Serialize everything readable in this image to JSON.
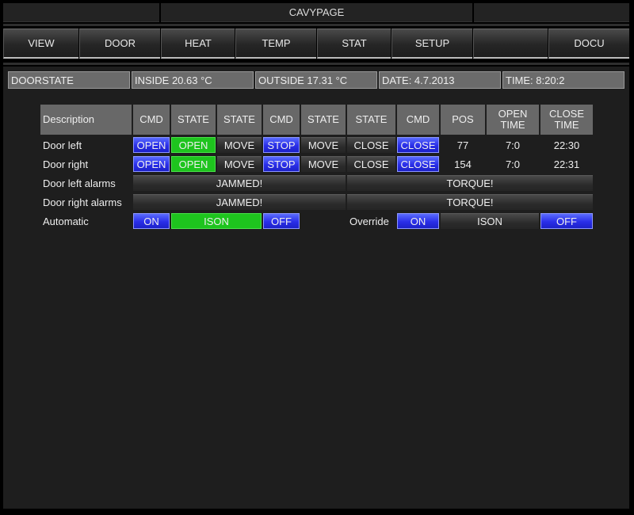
{
  "title": "CAVYPAGE",
  "nav": [
    "VIEW",
    "DOOR",
    "HEAT",
    "TEMP",
    "STAT",
    "SETUP",
    "",
    "DOCU"
  ],
  "status": {
    "name": "DOORSTATE",
    "inside": "INSIDE 20.63 °C",
    "outside": "OUTSIDE 17.31 °C",
    "date": "DATE: 4.7.2013",
    "time": "TIME: 8:20:2"
  },
  "headers": [
    "Description",
    "CMD",
    "STATE",
    "STATE",
    "CMD",
    "STATE",
    "STATE",
    "CMD",
    "POS",
    "OPEN\nTIME",
    "CLOSE\nTIME"
  ],
  "doors": [
    {
      "label": "Door left",
      "cmd_open": "OPEN",
      "state_open": "OPEN",
      "state_move": "MOVE",
      "cmd_stop": "STOP",
      "state_move2": "MOVE",
      "state_close": "CLOSE",
      "cmd_close": "CLOSE",
      "pos": "77",
      "open_time": "7:0",
      "close_time": "22:30"
    },
    {
      "label": "Door right",
      "cmd_open": "OPEN",
      "state_open": "OPEN",
      "state_move": "MOVE",
      "cmd_stop": "STOP",
      "state_move2": "MOVE",
      "state_close": "CLOSE",
      "cmd_close": "CLOSE",
      "pos": "154",
      "open_time": "7:0",
      "close_time": "22:31"
    }
  ],
  "alarms": [
    {
      "label": "Door left alarms",
      "jammed": "JAMMED!",
      "torque": "TORQUE!"
    },
    {
      "label": "Door right alarms",
      "jammed": "JAMMED!",
      "torque": "TORQUE!"
    }
  ],
  "automatic": {
    "label": "Automatic",
    "on": "ON",
    "ison": "ISON",
    "off": "OFF",
    "override_label": "Override",
    "override_on": "ON",
    "override_ison": "ISON",
    "override_off": "OFF"
  },
  "colors": {
    "command_blue": "#2a2ee8",
    "state_active_green": "#1ec41e",
    "background": "#1e1e1e"
  }
}
